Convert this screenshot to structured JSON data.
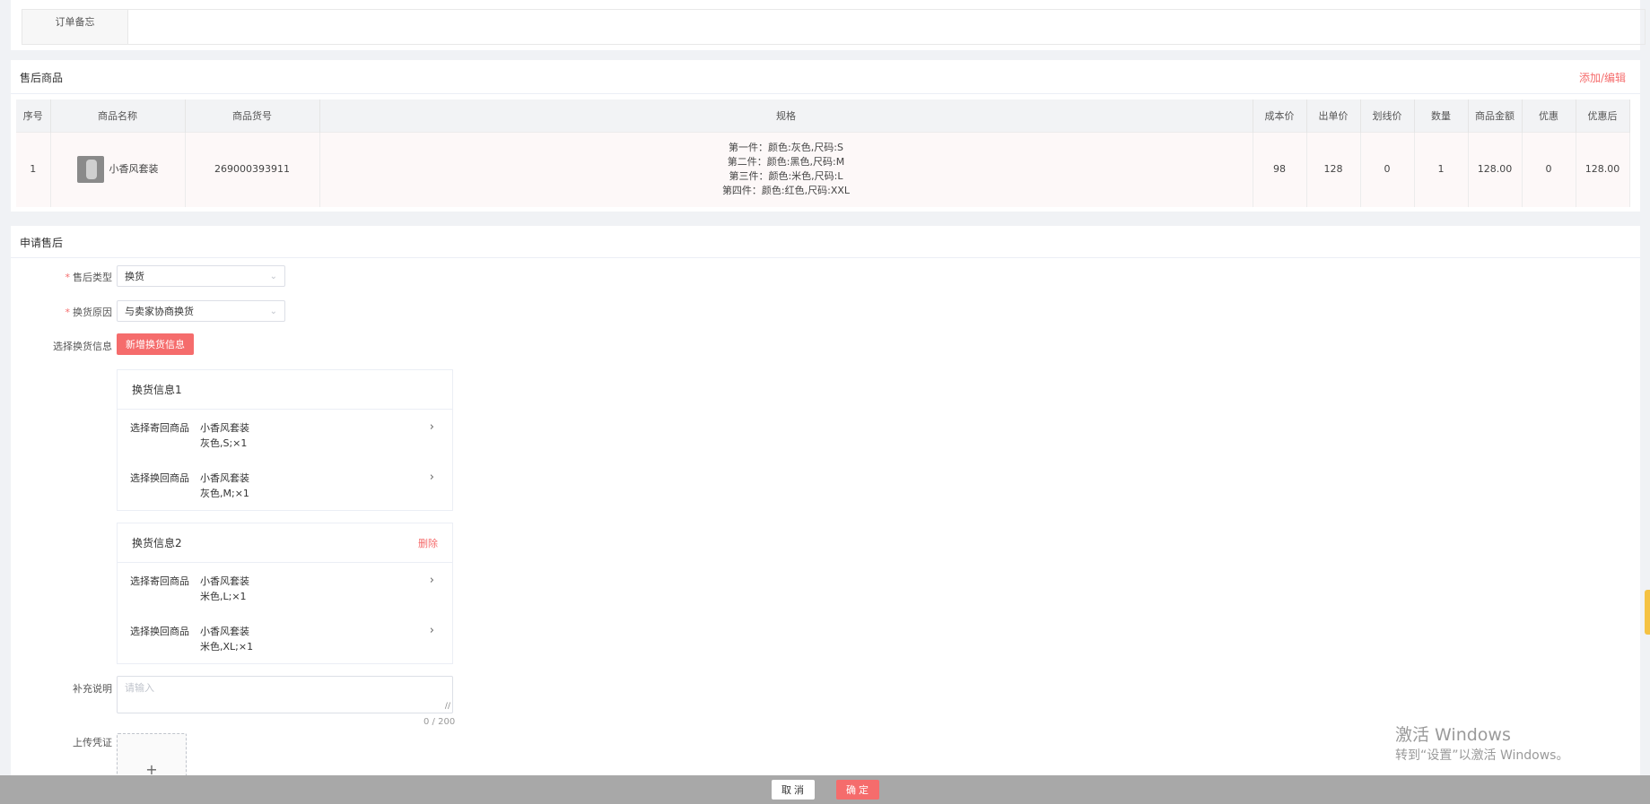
{
  "memo": {
    "label": "订单备忘",
    "value": ""
  },
  "goods": {
    "title": "售后商品",
    "edit_link": "添加/编辑",
    "columns": [
      "序号",
      "商品名称",
      "商品货号",
      "规格",
      "成本价",
      "出单价",
      "划线价",
      "数量",
      "商品金额",
      "优惠",
      "优惠后"
    ],
    "rows": [
      {
        "index": "1",
        "name": "小香风套装",
        "sku": "269000393911",
        "specs": [
          "第一件：颜色:灰色,尺码:S",
          "第二件：颜色:黑色,尺码:M",
          "第三件：颜色:米色,尺码:L",
          "第四件：颜色:红色,尺码:XXL"
        ],
        "cost": "98",
        "price": "128",
        "list_price": "0",
        "qty": "1",
        "amount": "128.00",
        "discount": "0",
        "after_discount": "128.00"
      }
    ]
  },
  "apply": {
    "title": "申请售后",
    "type_label": "售后类型",
    "type_value": "换货",
    "reason_label": "换货原因",
    "reason_value": "与卖家协商换货",
    "select_label": "选择换货信息",
    "add_button": "新增换货信息",
    "exchanges": [
      {
        "title": "换货信息1",
        "delete": "",
        "send_label": "选择寄回商品",
        "send_name": "小香风套装",
        "send_spec": "灰色,S;×1",
        "recv_label": "选择换回商品",
        "recv_name": "小香风套装",
        "recv_spec": "灰色,M;×1"
      },
      {
        "title": "换货信息2",
        "delete": "删除",
        "send_label": "选择寄回商品",
        "send_name": "小香风套装",
        "send_spec": "米色,L;×1",
        "recv_label": "选择换回商品",
        "recv_name": "小香风套装",
        "recv_spec": "米色,XL;×1"
      }
    ],
    "note_label": "补充说明",
    "note_placeholder": "请输入",
    "note_counter": "0 / 200",
    "upload_label": "上传凭证",
    "upload_plus": "+"
  },
  "footer": {
    "cancel": "取 消",
    "confirm": "确 定"
  },
  "watermark": {
    "line1": "激活 Windows",
    "line2": "转到“设置”以激活 Windows。"
  },
  "icons": {
    "chevron": "chevron-right-icon",
    "dropdown": "chevron-down-icon"
  },
  "colors": {
    "accent": "#f56c6c"
  }
}
